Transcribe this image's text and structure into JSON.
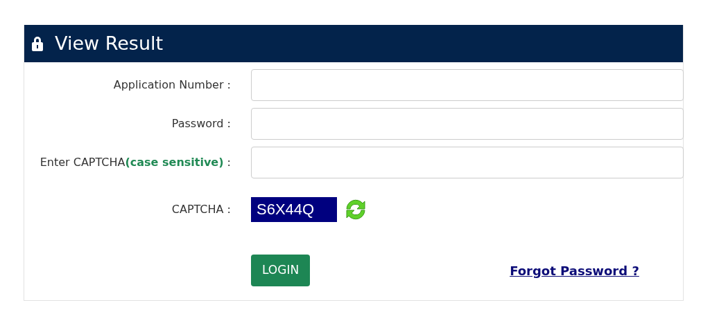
{
  "panel": {
    "title": "View Result"
  },
  "fields": [
    {
      "kind": "input",
      "label": "Application Number :"
    },
    {
      "kind": "input",
      "label": "Password :"
    },
    {
      "kind": "input",
      "label": "Enter CAPTCHA**(case sensitive)** :"
    },
    {
      "kind": "captcha",
      "label": "CAPTCHA :",
      "code": "S6X44Q"
    }
  ],
  "login_button": "LOGIN",
  "forgot_link": "Forgot Password ?"
}
